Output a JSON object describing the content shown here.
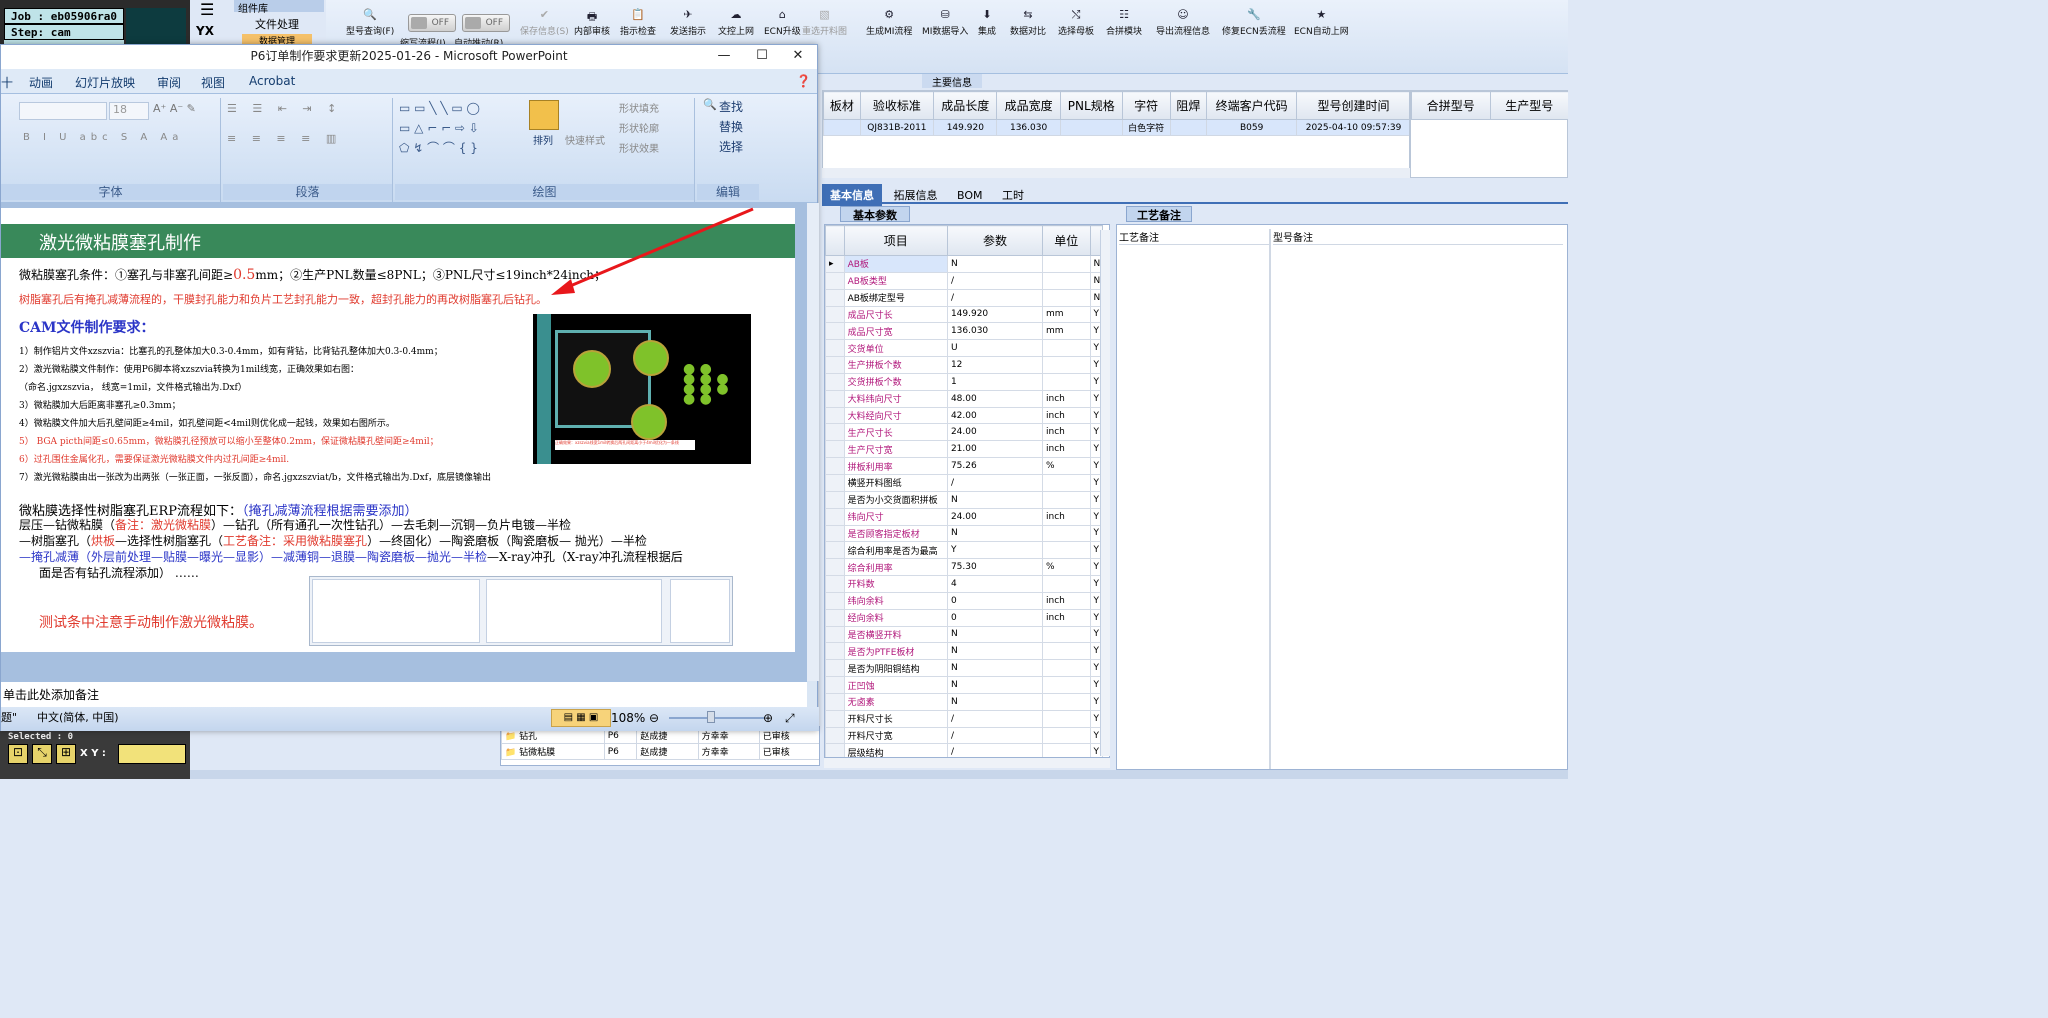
{
  "cam": {
    "job_label": "Job : eb05906ra0",
    "step_label": "Step: cam",
    "selected_label": "Selected : 0",
    "xy_label": "X Y :"
  },
  "erp": {
    "top_tabs": [
      "组件库",
      "文件处理",
      "数据管理"
    ],
    "toolbar": [
      {
        "label": "型号查询(F)",
        "icon": "search-icon",
        "enabled": true
      },
      {
        "label": "缩写流程(J)",
        "icon": "toggle-icon",
        "enabled": true
      },
      {
        "label": "自动推动(R)",
        "icon": "toggle-icon",
        "enabled": true
      },
      {
        "label": "保存信息(S)",
        "icon": "check-icon",
        "enabled": false
      },
      {
        "label": "内部审核",
        "icon": "print-icon",
        "enabled": true
      },
      {
        "label": "指示检查",
        "icon": "clipboard-check-icon",
        "enabled": true
      },
      {
        "label": "发送指示",
        "icon": "send-icon",
        "enabled": true
      },
      {
        "label": "文控上网",
        "icon": "cloud-upload-icon",
        "enabled": true
      },
      {
        "label": "ECN升级",
        "icon": "building-icon",
        "enabled": true
      },
      {
        "label": "重选开料图",
        "icon": "image-icon",
        "enabled": false
      },
      {
        "label": "生成MI流程",
        "icon": "gears-icon",
        "enabled": true
      },
      {
        "label": "MI数据导入",
        "icon": "database-import-icon",
        "enabled": true
      },
      {
        "label": "集成",
        "icon": "download-icon",
        "enabled": true
      },
      {
        "label": "数据对比",
        "icon": "compare-icon",
        "enabled": true
      },
      {
        "label": "选择母板",
        "icon": "shuffle-icon",
        "enabled": true
      },
      {
        "label": "合拼模块",
        "icon": "list-icon",
        "enabled": true
      },
      {
        "label": "导出流程信息",
        "icon": "smile-icon",
        "enabled": true
      },
      {
        "label": "修复ECN丢流程",
        "icon": "wrench-icon",
        "enabled": true
      },
      {
        "label": "ECN自动上网",
        "icon": "star-icon",
        "enabled": true
      }
    ],
    "toggle_off": "OFF",
    "main_info_label": "主要信息",
    "main_table": {
      "headers": [
        "板材",
        "验收标准",
        "成品长度",
        "成品宽度",
        "PNL规格",
        "字符",
        "阻焊",
        "终端客户代码",
        "型号创建时间"
      ],
      "row": [
        "",
        "QJ831B-2011",
        "149.920",
        "136.030",
        "",
        "白色字符",
        "",
        "B059",
        "2025-04-10 09:57:39"
      ]
    },
    "right_table_headers": [
      "合拼型号",
      "生产型号"
    ],
    "sub_tabs": [
      "基本信息",
      "拓展信息",
      "BOM",
      "工时"
    ],
    "basic_params_tab": "基本参数",
    "process_notes_tab": "工艺备注",
    "param_headers": [
      "项目",
      "参数",
      "单位"
    ],
    "params": [
      {
        "name": "AB板",
        "value": "N",
        "unit": "",
        "flag": "N",
        "pink": true,
        "sel": true
      },
      {
        "name": "AB板类型",
        "value": "/",
        "unit": "",
        "flag": "N",
        "pink": true
      },
      {
        "name": "AB板绑定型号",
        "value": "/",
        "unit": "",
        "flag": "N",
        "pink": false
      },
      {
        "name": "成品尺寸长",
        "value": "149.920",
        "unit": "mm",
        "flag": "Y",
        "pink": true
      },
      {
        "name": "成品尺寸宽",
        "value": "136.030",
        "unit": "mm",
        "flag": "Y",
        "pink": true
      },
      {
        "name": "交货单位",
        "value": "U",
        "unit": "",
        "flag": "Y",
        "pink": true
      },
      {
        "name": "生产拼板个数",
        "value": "12",
        "unit": "",
        "flag": "Y",
        "pink": true
      },
      {
        "name": "交货拼板个数",
        "value": "1",
        "unit": "",
        "flag": "Y",
        "pink": true
      },
      {
        "name": "大料纬向尺寸",
        "value": "48.00",
        "unit": "inch",
        "flag": "Y",
        "pink": true
      },
      {
        "name": "大料经向尺寸",
        "value": "42.00",
        "unit": "inch",
        "flag": "Y",
        "pink": true
      },
      {
        "name": "生产尺寸长",
        "value": "24.00",
        "unit": "inch",
        "flag": "Y",
        "pink": true
      },
      {
        "name": "生产尺寸宽",
        "value": "21.00",
        "unit": "inch",
        "flag": "Y",
        "pink": true
      },
      {
        "name": "拼板利用率",
        "value": "75.26",
        "unit": "%",
        "flag": "Y",
        "pink": true
      },
      {
        "name": "横竖开料图纸",
        "value": "/",
        "unit": "",
        "flag": "Y",
        "pink": false
      },
      {
        "name": "是否为小交货面积拼板",
        "value": "N",
        "unit": "",
        "flag": "Y",
        "pink": false
      },
      {
        "name": "纬向尺寸",
        "value": "24.00",
        "unit": "inch",
        "flag": "Y",
        "pink": true
      },
      {
        "name": "是否顾客指定板材",
        "value": "N",
        "unit": "",
        "flag": "Y",
        "pink": true
      },
      {
        "name": "综合利用率是否为最高",
        "value": "Y",
        "unit": "",
        "flag": "Y",
        "pink": false
      },
      {
        "name": "综合利用率",
        "value": "75.30",
        "unit": "%",
        "flag": "Y",
        "pink": true
      },
      {
        "name": "开料数",
        "value": "4",
        "unit": "",
        "flag": "Y",
        "pink": true
      },
      {
        "name": "纬向余料",
        "value": "0",
        "unit": "inch",
        "flag": "Y",
        "pink": true
      },
      {
        "name": "经向余料",
        "value": "0",
        "unit": "inch",
        "flag": "Y",
        "pink": true
      },
      {
        "name": "是否横竖开料",
        "value": "N",
        "unit": "",
        "flag": "Y",
        "pink": true
      },
      {
        "name": "是否为PTFE板材",
        "value": "N",
        "unit": "",
        "flag": "Y",
        "pink": true
      },
      {
        "name": "是否为阴阳铜结构",
        "value": "N",
        "unit": "",
        "flag": "Y",
        "pink": false
      },
      {
        "name": "正凹蚀",
        "value": "N",
        "unit": "",
        "flag": "Y",
        "pink": true
      },
      {
        "name": "无卤素",
        "value": "N",
        "unit": "",
        "flag": "Y",
        "pink": true
      },
      {
        "name": "开料尺寸长",
        "value": "/",
        "unit": "",
        "flag": "Y",
        "pink": false
      },
      {
        "name": "开料尺寸宽",
        "value": "/",
        "unit": "",
        "flag": "Y",
        "pink": false
      },
      {
        "name": "层级结构",
        "value": "/",
        "unit": "",
        "flag": "Y",
        "pink": false
      }
    ],
    "notes_headers": [
      "工艺备注",
      "型号备注"
    ],
    "bottom_rows": [
      [
        "钻孔",
        "P6",
        "赵成捷",
        "方幸幸",
        "已审核"
      ],
      [
        "钻微粘膜",
        "P6",
        "赵成捷",
        "方幸幸",
        "已审核"
      ]
    ]
  },
  "ppt": {
    "title": "P6订单制作要求更新2025-01-26 - Microsoft PowerPoint",
    "tabs": [
      "动画",
      "幻灯片放映",
      "审阅",
      "视图",
      "Acrobat"
    ],
    "font_size": "18",
    "groups": [
      "字体",
      "段落",
      "绘图",
      "编辑"
    ],
    "draw_buttons": [
      "排列",
      "快速样式",
      "形状填充",
      "形状轮廓",
      "形状效果"
    ],
    "edit_buttons": [
      "查找",
      "替换",
      "选择"
    ],
    "notes_placeholder": "单击此处添加备注",
    "status_theme": "题\"",
    "status_lang": "中文(简体, 中国)",
    "zoom": "108%"
  },
  "slide": {
    "title": "激光微粘膜塞孔制作",
    "cond_prefix": "微粘膜塞孔条件：①塞孔与非塞孔间距≥",
    "cond_num": "0.5",
    "cond_suffix": "mm；②生产PNL数量≤8PNL；③PNL尺寸≤19inch*24inch；",
    "red_note": "树脂塞孔后有掩孔减薄流程的，干膜封孔能力和负片工艺封孔能力一致，超封孔能力的再改树脂塞孔后钻孔。",
    "cam_heading": "CAM文件制作要求：",
    "items": [
      "1）制作铝片文件xzszvia：比塞孔的孔整体加大0.3-0.4mm，如有背钻，比背钻孔整体加大0.3-0.4mm；",
      "2）激光微粘膜文件制作：使用P6脚本将xzszvia转换为1mil线宽，正确效果如右图：",
      "（命名.jgxzszvia， 线宽=1mil，文件格式输出为.Dxf）",
      "3）微粘膜加大后距离非塞孔≥0.3mm；",
      "4）微粘膜文件加大后孔壁间距≥4mil，如孔壁间距<4mil则优化成一起钱，效果如右图所示。",
      "5） BGA picth间距≤0.65mm，微粘膜孔径预放可以缩小至整体0.2mm，保证微粘膜孔壁间距≥4mil；",
      "6）过孔围住金属化孔，需要保证激光微粘膜文件内过孔间距≥4mil.",
      "7）激光微粘膜由出一张改为出两张（一张正面，一张反面），命名.jgxzszviat/b，文件格式输出为.Dxf，底层镜像输出"
    ],
    "flow_intro": "微粘膜选择性树脂塞孔ERP流程如下：",
    "flow_intro_note": "（掩孔减薄流程根据需要添加）",
    "flow1": "层压—钻微粘膜（",
    "flow1_note": "备注：激光微粘膜",
    "flow1_tail": "）—钻孔（所有通孔一次性钻孔）—去毛刺—沉铜—负片电镀—半检",
    "flow2": "—树脂塞孔（",
    "flow2_note": "烘板",
    "flow2_mid": "—选择性树脂塞孔（",
    "flow2_note2": "工艺备注：采用微粘膜塞孔",
    "flow2_tail": "）—终固化）—陶瓷磨板（陶瓷磨板— 抛光）—半检",
    "flow3_blue": "—掩孔减薄（外层前处理—贴膜—曝光—显影）—减薄铜—退膜—陶瓷磨板—抛光—半检",
    "flow3_tail": "—X-ray冲孔（X-ray冲孔流程根据后",
    "flow4": "面是否有钻孔流程添加）  ……",
    "test_note": "测试条中注意手动制作激光微粘膜。",
    "img_caption": "正确效果：xzszvia线宽1mil转换后两孔间距离小于4mil优化为一条线"
  }
}
